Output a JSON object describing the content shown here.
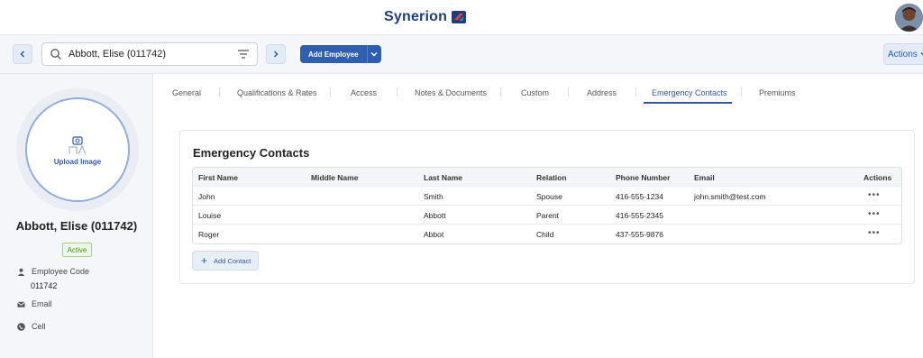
{
  "app": {
    "name": "Synerion"
  },
  "search": {
    "value": "Abbott, Elise (011742)"
  },
  "toolbar": {
    "add_employee_label": "Add Employee",
    "actions_label": "Actions"
  },
  "employee": {
    "upload_label": "Upload Image",
    "name": "Abbott, Elise (011742)",
    "status": "Active",
    "code_label": "Employee Code",
    "code_value": "011742",
    "email_label": "Email",
    "cell_label": "Cell"
  },
  "tabs": [
    {
      "label": "General"
    },
    {
      "label": "Qualifications & Rates"
    },
    {
      "label": "Access"
    },
    {
      "label": "Notes & Documents"
    },
    {
      "label": "Custom"
    },
    {
      "label": "Address"
    },
    {
      "label": "Emergency Contacts"
    },
    {
      "label": "Premiums"
    }
  ],
  "active_tab": "Emergency Contacts",
  "contacts": {
    "title": "Emergency Contacts",
    "columns": [
      "First Name",
      "Middle Name",
      "Last Name",
      "Relation",
      "Phone Number",
      "Email",
      "Actions"
    ],
    "rows": [
      {
        "first": "John",
        "middle": "",
        "last": "Smith",
        "relation": "Spouse",
        "phone": "416-555-1234",
        "email": "john.smith@test.com",
        "actions": "•••"
      },
      {
        "first": "Louise",
        "middle": "",
        "last": "Abbott",
        "relation": "Parent",
        "phone": "416-555-2345",
        "email": "",
        "actions": "•••"
      },
      {
        "first": "Roger",
        "middle": "",
        "last": "Abbot",
        "relation": "Child",
        "phone": "437-555-9876",
        "email": "",
        "actions": "•••"
      }
    ],
    "add_label": "Add Contact"
  },
  "icons": {
    "prev": "chevron-left-icon",
    "next": "chevron-right-icon",
    "search": "search-icon",
    "filter": "filter-icon",
    "dropdown": "chevron-down-icon",
    "upload": "camera-upload-icon",
    "code": "person-icon",
    "email": "envelope-icon",
    "cell": "phone-icon",
    "row_actions": "more-horizontal-icon",
    "add": "plus-icon"
  },
  "colors": {
    "primary": "#2f5fb0",
    "accent_blue": "#2f5aa8",
    "brand_red": "#e0463a",
    "active_green": "#4a8a28"
  }
}
